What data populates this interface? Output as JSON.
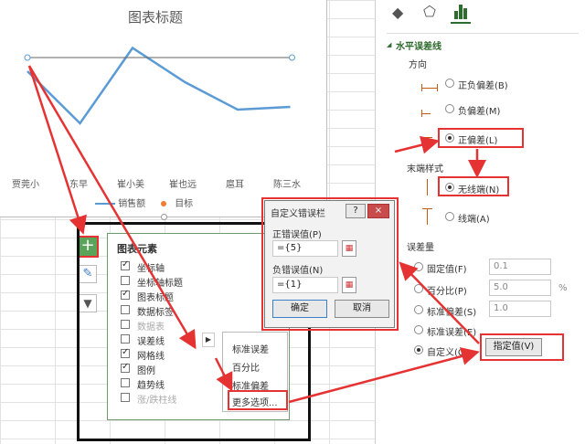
{
  "chart": {
    "title": "图表标题",
    "categories": [
      "贾莞小",
      "东早",
      "崔小美",
      "崔也远",
      "扈耳",
      "陈三水"
    ],
    "legend": {
      "series1": "销售额",
      "series2": "目标"
    },
    "colors": {
      "line": "#5b9bd5",
      "target": "#ed7d31"
    }
  },
  "chart_data": {
    "type": "line",
    "title": "图表标题",
    "categories": [
      "贾莞小",
      "东早",
      "崔小美",
      "崔也远",
      "扈耳",
      "陈三水"
    ],
    "series": [
      {
        "name": "销售额",
        "values": [
          68,
          30,
          85,
          60,
          40,
          42
        ]
      },
      {
        "name": "目标",
        "values": [
          78,
          null,
          null,
          null,
          null,
          78
        ]
      }
    ],
    "ylim": [
      0,
      100
    ]
  },
  "format_pane": {
    "section_title": "水平误差线",
    "direction_label": "方向",
    "direction_options": [
      "正负偏差(B)",
      "负偏差(M)",
      "正偏差(L)"
    ],
    "end_style_label": "末端样式",
    "end_style_options": [
      "无线端(N)",
      "线端(A)"
    ],
    "error_amount_label": "误差量",
    "amount_options": [
      "固定值(F)",
      "百分比(P)",
      "标准偏差(S)",
      "标准误差(E)",
      "自定义(C)"
    ],
    "fixed_value": "0.1",
    "percent_value": "5.0",
    "percent_unit": "%",
    "stddev_value": "1.0",
    "specify_button": "指定值(V)"
  },
  "elements_panel": {
    "title": "图表元素",
    "items": [
      "坐标轴",
      "坐标轴标题",
      "图表标题",
      "数据标签",
      "数据表",
      "误差线",
      "网格线",
      "图例",
      "趋势线",
      "涨/跌柱线"
    ],
    "submenu": [
      "标准误差",
      "百分比",
      "标准偏差",
      "更多选项..."
    ]
  },
  "dialog": {
    "title": "自定义错误栏",
    "help": "?",
    "close": "×",
    "positive_label": "正错误值(P)",
    "positive_value": "={5}",
    "negative_label": "负错误值(N)",
    "negative_value": "={1}",
    "ok": "确定",
    "cancel": "取消"
  }
}
